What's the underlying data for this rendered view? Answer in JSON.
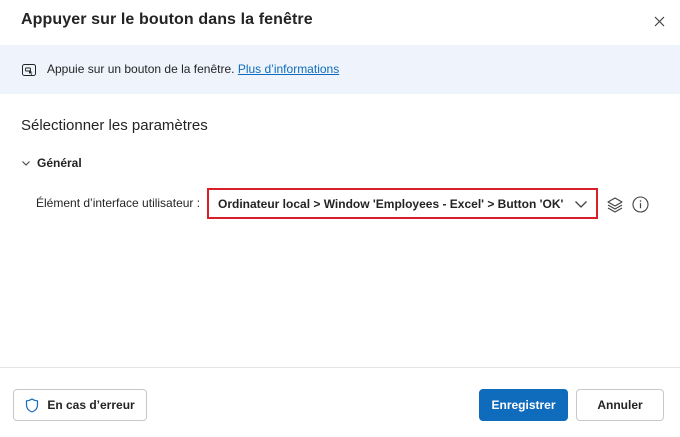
{
  "dialog": {
    "title": "Appuyer sur le bouton dans la fenêtre",
    "close_icon": "close-icon"
  },
  "banner": {
    "icon": "window-button-icon",
    "text": "Appuie sur un bouton de la fenêtre.",
    "link": "Plus d’informations"
  },
  "section": {
    "title": "Sélectionner les paramètres"
  },
  "group": {
    "label": "Général",
    "expanded": true,
    "icon": "chevron-down-icon"
  },
  "field": {
    "label": "Élément d’interface utilisateur :",
    "value": "Ordinateur local > Window 'Employees - Excel' > Button 'OK'",
    "layers_icon": "layers-icon",
    "info_icon": "info-icon"
  },
  "footer": {
    "on_error_label": "En cas d’erreur",
    "on_error_icon": "shield-icon",
    "save_label": "Enregistrer",
    "cancel_label": "Annuler"
  },
  "colors": {
    "accent": "#0f6cbd",
    "banner_bg": "#eff4fc",
    "highlight": "#d9202a"
  }
}
